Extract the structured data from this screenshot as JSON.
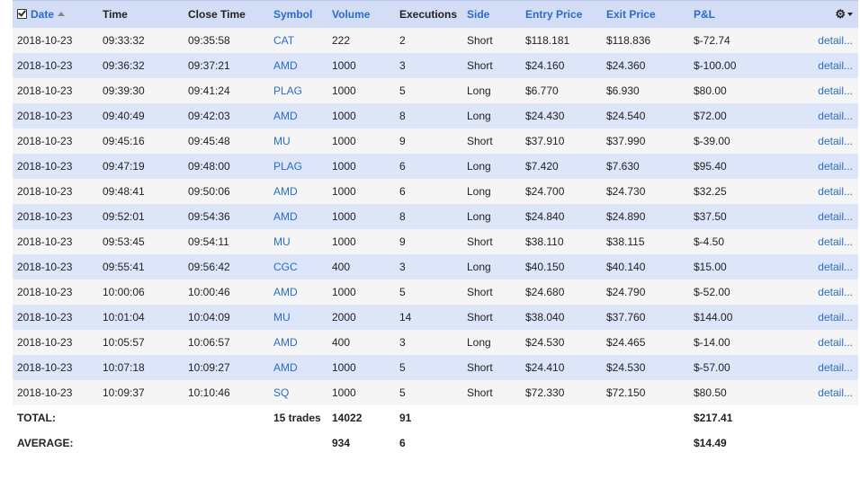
{
  "header": {
    "date": "Date",
    "time": "Time",
    "close_time": "Close Time",
    "symbol": "Symbol",
    "volume": "Volume",
    "executions": "Executions",
    "side": "Side",
    "entry_price": "Entry Price",
    "exit_price": "Exit Price",
    "pnl": "P&L",
    "gear_icon": "gear-icon"
  },
  "colors": {
    "header_bg": "#d3ddf6",
    "link": "#2a6cc8",
    "row_odd": "#f5f5f5",
    "row_even": "#dde5f8"
  },
  "detail_label": "detail...",
  "rows": [
    {
      "date": "2018-10-23",
      "time": "09:33:32",
      "close_time": "09:35:58",
      "symbol": "CAT",
      "volume": "222",
      "executions": "2",
      "side": "Short",
      "entry": "$118.181",
      "exit": "$118.836",
      "pnl": "$-72.74"
    },
    {
      "date": "2018-10-23",
      "time": "09:36:32",
      "close_time": "09:37:21",
      "symbol": "AMD",
      "volume": "1000",
      "executions": "3",
      "side": "Short",
      "entry": "$24.160",
      "exit": "$24.360",
      "pnl": "$-100.00"
    },
    {
      "date": "2018-10-23",
      "time": "09:39:30",
      "close_time": "09:41:24",
      "symbol": "PLAG",
      "volume": "1000",
      "executions": "5",
      "side": "Long",
      "entry": "$6.770",
      "exit": "$6.930",
      "pnl": "$80.00"
    },
    {
      "date": "2018-10-23",
      "time": "09:40:49",
      "close_time": "09:42:03",
      "symbol": "AMD",
      "volume": "1000",
      "executions": "8",
      "side": "Long",
      "entry": "$24.430",
      "exit": "$24.540",
      "pnl": "$72.00"
    },
    {
      "date": "2018-10-23",
      "time": "09:45:16",
      "close_time": "09:45:48",
      "symbol": "MU",
      "volume": "1000",
      "executions": "9",
      "side": "Short",
      "entry": "$37.910",
      "exit": "$37.990",
      "pnl": "$-39.00"
    },
    {
      "date": "2018-10-23",
      "time": "09:47:19",
      "close_time": "09:48:00",
      "symbol": "PLAG",
      "volume": "1000",
      "executions": "6",
      "side": "Long",
      "entry": "$7.420",
      "exit": "$7.630",
      "pnl": "$95.40"
    },
    {
      "date": "2018-10-23",
      "time": "09:48:41",
      "close_time": "09:50:06",
      "symbol": "AMD",
      "volume": "1000",
      "executions": "6",
      "side": "Long",
      "entry": "$24.700",
      "exit": "$24.730",
      "pnl": "$32.25"
    },
    {
      "date": "2018-10-23",
      "time": "09:52:01",
      "close_time": "09:54:36",
      "symbol": "AMD",
      "volume": "1000",
      "executions": "8",
      "side": "Long",
      "entry": "$24.840",
      "exit": "$24.890",
      "pnl": "$37.50"
    },
    {
      "date": "2018-10-23",
      "time": "09:53:45",
      "close_time": "09:54:11",
      "symbol": "MU",
      "volume": "1000",
      "executions": "9",
      "side": "Short",
      "entry": "$38.110",
      "exit": "$38.115",
      "pnl": "$-4.50"
    },
    {
      "date": "2018-10-23",
      "time": "09:55:41",
      "close_time": "09:56:42",
      "symbol": "CGC",
      "volume": "400",
      "executions": "3",
      "side": "Long",
      "entry": "$40.150",
      "exit": "$40.140",
      "pnl": "$15.00"
    },
    {
      "date": "2018-10-23",
      "time": "10:00:06",
      "close_time": "10:00:46",
      "symbol": "AMD",
      "volume": "1000",
      "executions": "5",
      "side": "Short",
      "entry": "$24.680",
      "exit": "$24.790",
      "pnl": "$-52.00"
    },
    {
      "date": "2018-10-23",
      "time": "10:01:04",
      "close_time": "10:04:09",
      "symbol": "MU",
      "volume": "2000",
      "executions": "14",
      "side": "Short",
      "entry": "$38.040",
      "exit": "$37.760",
      "pnl": "$144.00"
    },
    {
      "date": "2018-10-23",
      "time": "10:05:57",
      "close_time": "10:06:57",
      "symbol": "AMD",
      "volume": "400",
      "executions": "3",
      "side": "Long",
      "entry": "$24.530",
      "exit": "$24.465",
      "pnl": "$-14.00"
    },
    {
      "date": "2018-10-23",
      "time": "10:07:18",
      "close_time": "10:09:27",
      "symbol": "AMD",
      "volume": "1000",
      "executions": "5",
      "side": "Short",
      "entry": "$24.410",
      "exit": "$24.530",
      "pnl": "$-57.00"
    },
    {
      "date": "2018-10-23",
      "time": "10:09:37",
      "close_time": "10:10:46",
      "symbol": "SQ",
      "volume": "1000",
      "executions": "5",
      "side": "Short",
      "entry": "$72.330",
      "exit": "$72.150",
      "pnl": "$80.50"
    }
  ],
  "total": {
    "label": "TOTAL:",
    "trades": "15 trades",
    "volume": "14022",
    "executions": "91",
    "pnl": "$217.41"
  },
  "average": {
    "label": "AVERAGE:",
    "volume": "934",
    "executions": "6",
    "pnl": "$14.49"
  }
}
